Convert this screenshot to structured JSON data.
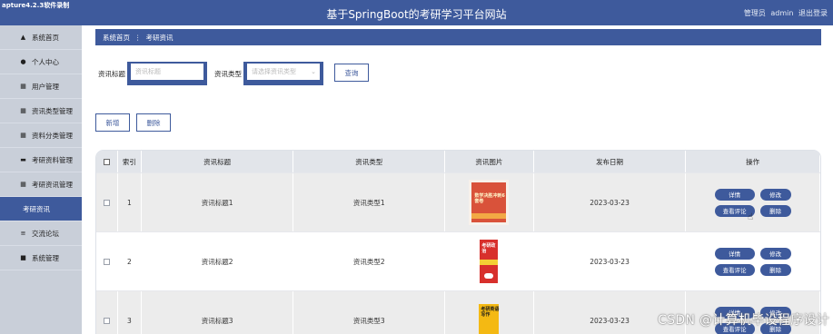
{
  "header": {
    "capture_label": "apture4.2.3软件录制",
    "title": "基于SpringBoot的考研学习平台网站",
    "user_role": "管理员",
    "username": "admin",
    "logout": "退出登录"
  },
  "sidebar": {
    "items": [
      {
        "label": "系统首页",
        "icon": "home-icon"
      },
      {
        "label": "个人中心",
        "icon": "person-icon"
      },
      {
        "label": "用户管理",
        "icon": "grid-icon"
      },
      {
        "label": "资讯类型管理",
        "icon": "grid-icon"
      },
      {
        "label": "资料分类管理",
        "icon": "grid-icon"
      },
      {
        "label": "考研资料管理",
        "icon": "video-icon"
      },
      {
        "label": "考研资讯管理",
        "icon": "grid-icon"
      },
      {
        "label": "考研资讯",
        "icon": "",
        "active": true
      },
      {
        "label": "交流论坛",
        "icon": "sliders-icon"
      },
      {
        "label": "系统管理",
        "icon": "briefcase-icon"
      }
    ]
  },
  "breadcrumb": {
    "home": "系统首页",
    "separator": "⋮",
    "current": "考研资讯"
  },
  "search": {
    "title_label": "资讯标题",
    "title_placeholder": "资讯标题",
    "type_label": "资讯类型",
    "type_placeholder": "请选择资讯类型",
    "query_button": "查询"
  },
  "actions": {
    "add": "新增",
    "delete": "删除"
  },
  "table": {
    "headers": [
      "索引",
      "资讯标题",
      "资讯类型",
      "资讯图片",
      "发布日期",
      "操作"
    ],
    "rows": [
      {
        "index": "1",
        "title": "资讯标题1",
        "type": "资讯类型1",
        "date": "2023-03-23",
        "cover_text": "数学决胜冲刺6套卷"
      },
      {
        "index": "2",
        "title": "资讯标题2",
        "type": "资讯类型2",
        "date": "2023-03-23",
        "cover_text": "考研政治"
      },
      {
        "index": "3",
        "title": "资讯标题3",
        "type": "资讯类型3",
        "date": "2023-03-23",
        "cover_text": "考研英语写作"
      }
    ],
    "op_labels": {
      "detail": "详情",
      "edit": "修改",
      "comments": "查看评论",
      "delete": "删除"
    }
  },
  "watermark": "CSDN @计算机毕设程序设计",
  "colors": {
    "primary": "#3e5a9c",
    "sidebar_bg": "#c9cfd9",
    "table_header_bg": "#e2e5ea"
  }
}
